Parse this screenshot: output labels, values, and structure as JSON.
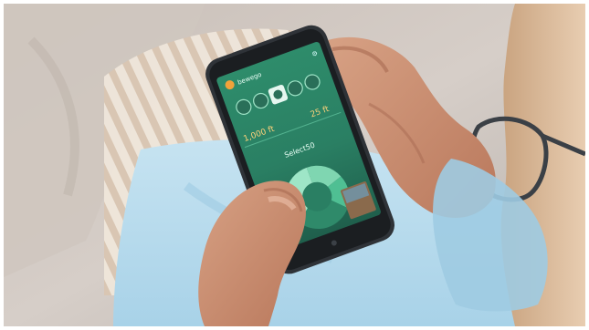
{
  "scene": {
    "colors": {
      "sheet": "#b8dcee",
      "pillow_stripe_a": "#d9c6b2",
      "pillow_stripe_b": "#efe6da",
      "bedding": "#cfc7c2",
      "skin": "#c98f73",
      "skin_shadow": "#a86a52",
      "phone_body": "#2f3338",
      "screen_green": "#2f8a6a",
      "screen_dark": "#1f5f4c",
      "accent_orange": "#f2a23a"
    }
  },
  "phone_screen": {
    "app_name": "bewego",
    "readout_left_value": "1,000 ft",
    "readout_right_value": "25 ft",
    "center_title": "Select50",
    "center_subtitle": "",
    "icons": [
      "settings-icon",
      "mode-icon-1",
      "mode-icon-2",
      "mode-icon-3",
      "mode-icon-4",
      "mode-icon-5"
    ]
  }
}
